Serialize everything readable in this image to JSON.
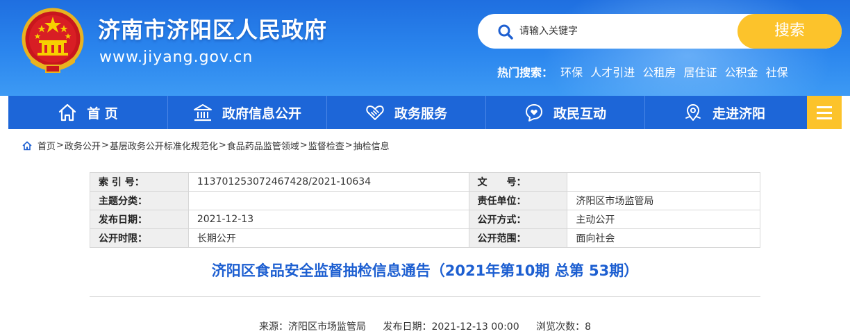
{
  "header": {
    "site_title": "济南市济阳区人民政府",
    "site_url": "www.jiyang.gov.cn",
    "search": {
      "placeholder": "请输入关键字",
      "button_label": "搜索"
    },
    "hot_search": {
      "label": "热门搜索：",
      "items": [
        "环保",
        "人才引进",
        "公租房",
        "居住证",
        "公积金",
        "社保"
      ]
    }
  },
  "nav": {
    "items": [
      {
        "label": "首 页",
        "icon": "home-icon"
      },
      {
        "label": "政府信息公开",
        "icon": "government-building-icon"
      },
      {
        "label": "政务服务",
        "icon": "handshake-heart-icon"
      },
      {
        "label": "政民互动",
        "icon": "heart-chat-icon"
      },
      {
        "label": "走进济阳",
        "icon": "location-pin-icon"
      }
    ],
    "menu_icon": "hamburger-menu-icon"
  },
  "breadcrumb": {
    "icon": "home-icon",
    "items": [
      "首页",
      "政务公开",
      "基层政务公开标准化规范化",
      "食品药品监管领域",
      "监督检查",
      "抽检信息"
    ],
    "separator": ">"
  },
  "info_table": {
    "rows": [
      {
        "k1": "索 引 号：",
        "v1": "113701253072467428/2021-10634",
        "k2": "文　　号：",
        "v2": ""
      },
      {
        "k1": "主题分类：",
        "v1": "",
        "k2": "责任单位：",
        "v2": "济阳区市场监管局"
      },
      {
        "k1": "发布日期：",
        "v1": "2021-12-13",
        "k2": "公开方式：",
        "v2": "主动公开"
      },
      {
        "k1": "公开时限：",
        "v1": "长期公开",
        "k2": "公开范围：",
        "v2": "面向社会"
      }
    ]
  },
  "article": {
    "title": "济阳区食品安全监督抽检信息通告（2021年第10期 总第 53期）",
    "meta": {
      "source": "来源：济阳区市场监管局",
      "date": "发布日期：2021-12-13 00:00",
      "views": "浏览次数：8"
    }
  },
  "colors": {
    "header_blue": "#2b86ee",
    "nav_blue": "#1d66d8",
    "accent_yellow": "#fcc32b",
    "title_blue": "#1d5fd1"
  }
}
